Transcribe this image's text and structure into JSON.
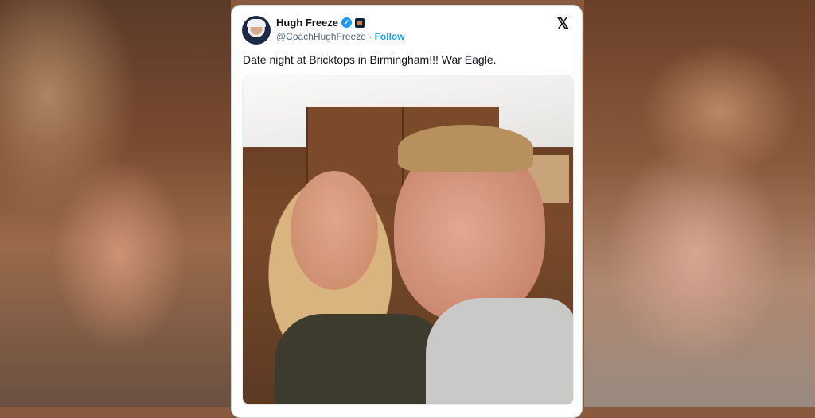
{
  "tweet": {
    "author_name": "Hugh Freeze",
    "verified_mark": "✓",
    "handle": "@CoachHughFreeze",
    "separator": " · ",
    "follow_label": "Follow",
    "x_logo": "𝕏",
    "text": "Date night at Bricktops in Birmingham!!! War Eagle."
  },
  "icons": {
    "verified": "verified-badge-icon",
    "affiliate": "affiliate-badge-icon",
    "platform": "x-logo-icon"
  },
  "colors": {
    "accent": "#1d9bf0",
    "text_primary": "#0f1419",
    "text_secondary": "#536471"
  }
}
